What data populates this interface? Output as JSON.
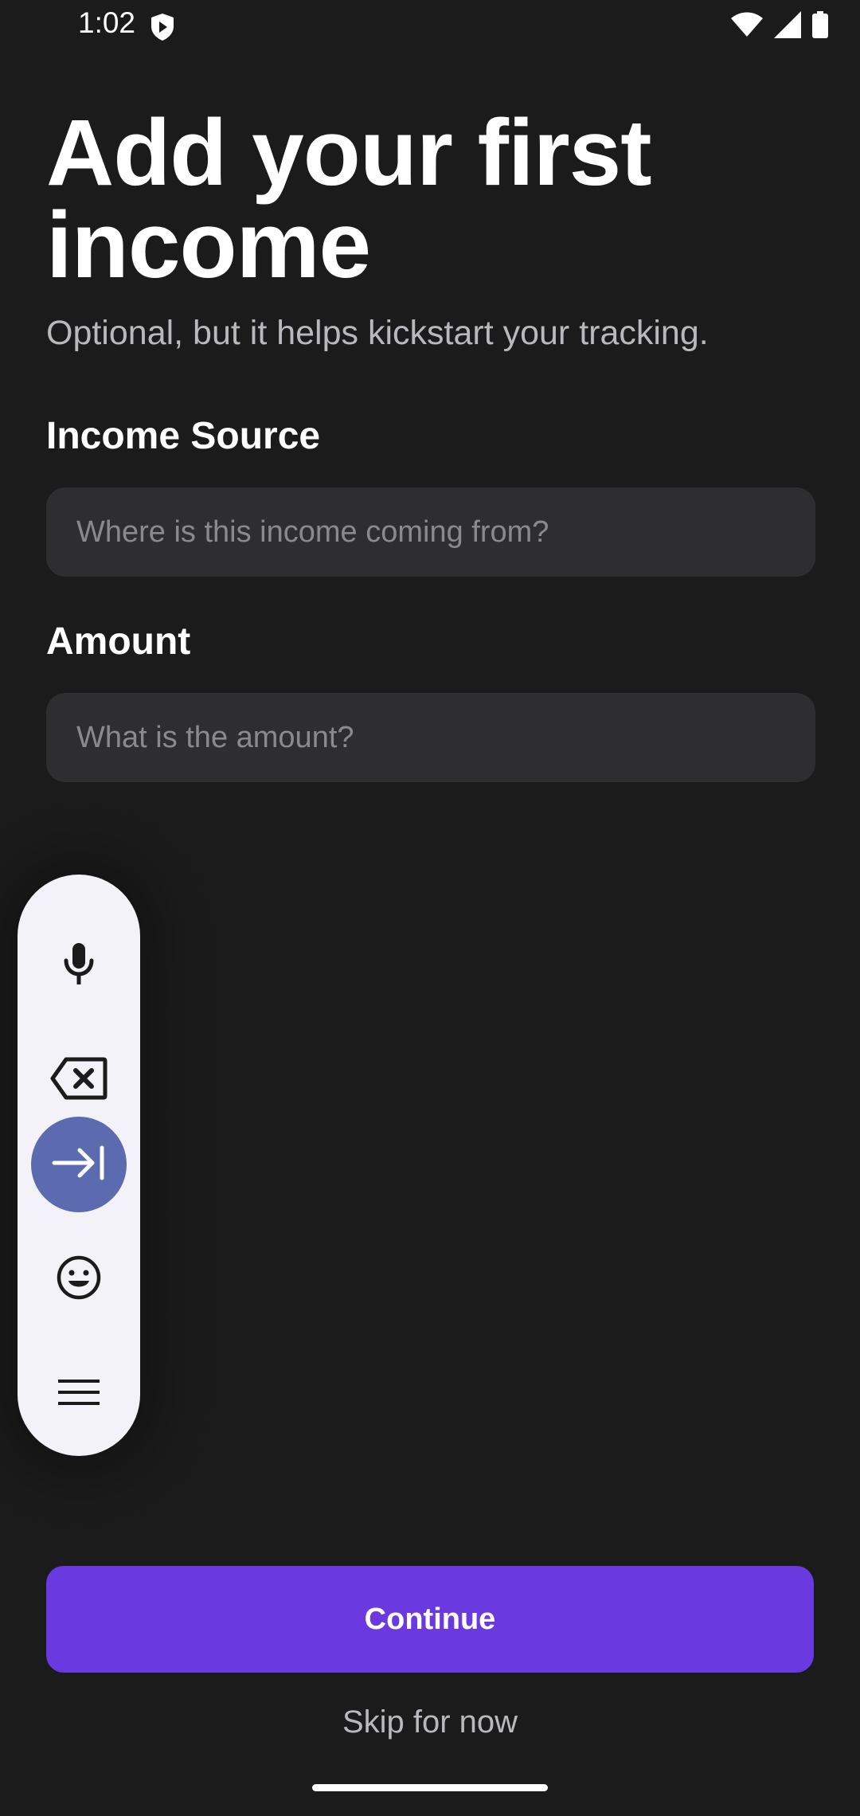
{
  "status_bar": {
    "time": "1:02",
    "icons": [
      "shield-icon",
      "wifi-icon",
      "signal-icon",
      "battery-icon"
    ]
  },
  "header": {
    "title": "Add your first income",
    "subtitle": "Optional, but it helps kickstart your tracking."
  },
  "form": {
    "income_source": {
      "label": "Income Source",
      "placeholder": "Where is this income coming from?",
      "value": ""
    },
    "amount": {
      "label": "Amount",
      "placeholder": "What is the amount?",
      "value": ""
    }
  },
  "keyboard_toolbar": {
    "items": [
      "microphone-icon",
      "backspace-icon",
      "tab-forward-icon",
      "emoji-icon",
      "menu-icon"
    ],
    "active": "tab-forward-icon"
  },
  "actions": {
    "continue_label": "Continue",
    "skip_label": "Skip for now"
  },
  "colors": {
    "background": "#1b1b1c",
    "input_background": "#2e2e30",
    "primary_button": "#6a3ae0",
    "toolbar_background": "#f3f2f9",
    "toolbar_active": "#5c6bb0"
  }
}
